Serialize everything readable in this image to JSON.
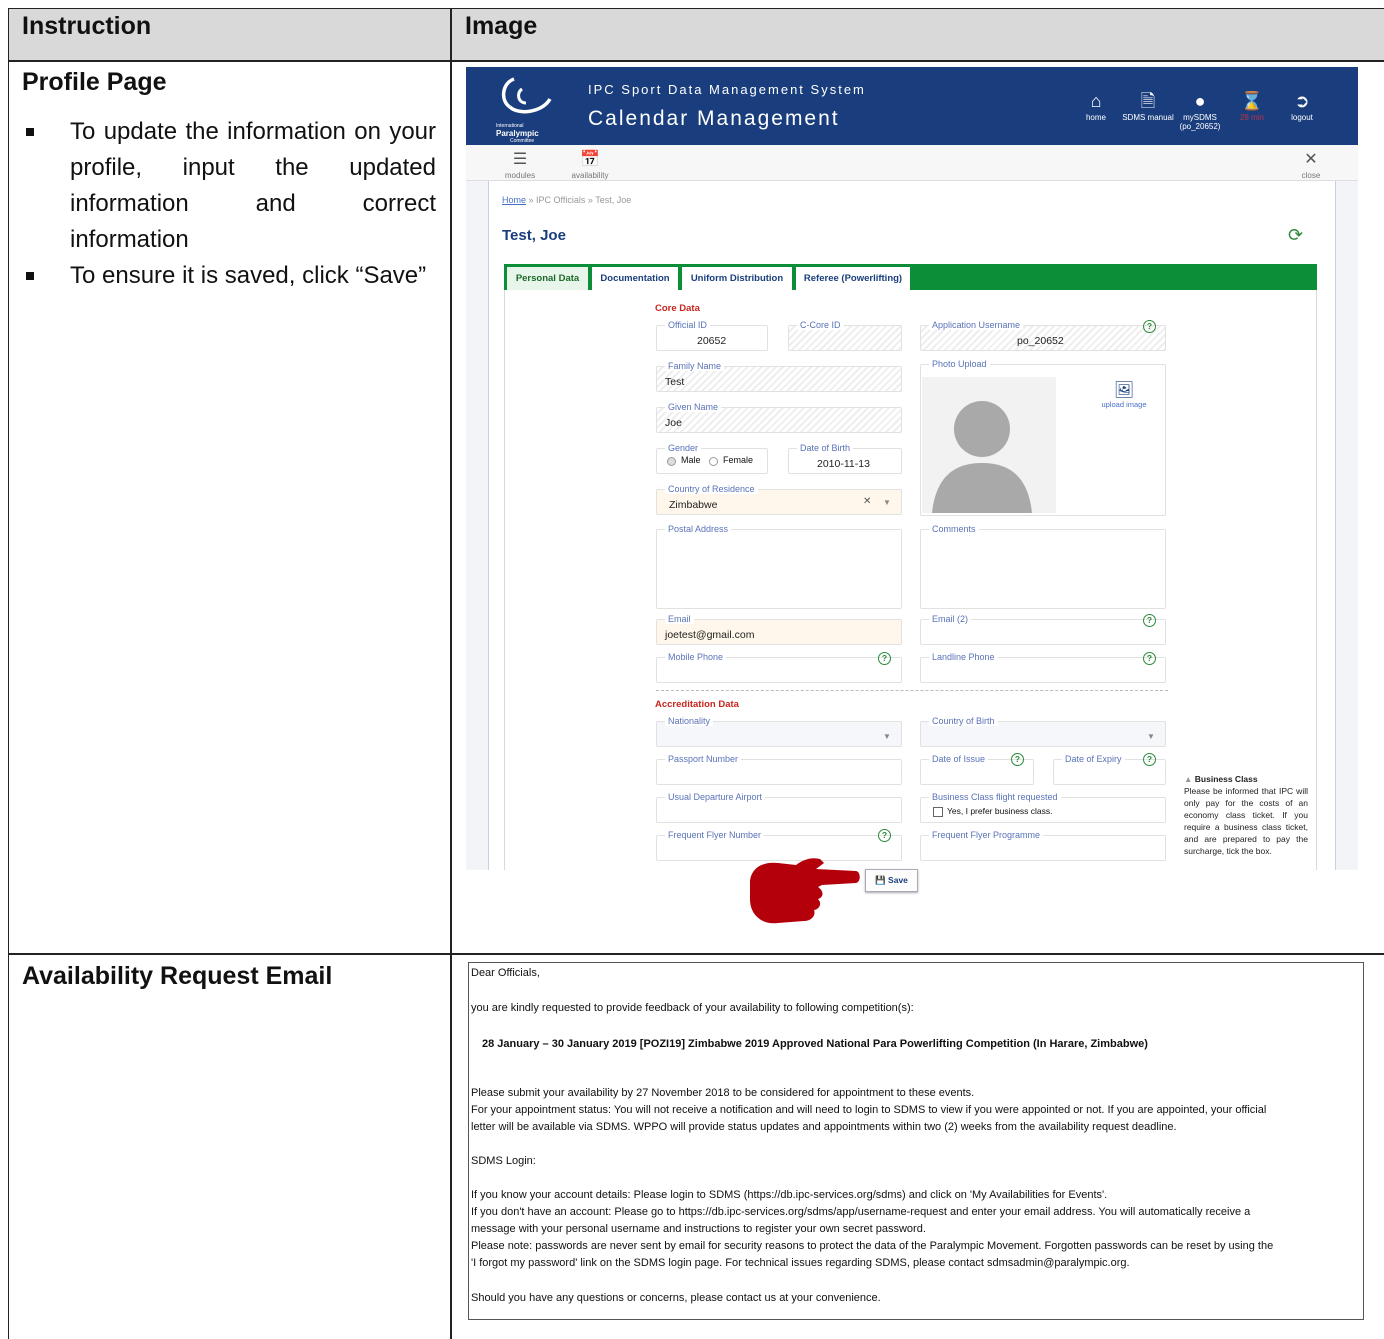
{
  "table": {
    "header": {
      "instruction": "Instruction",
      "image": "Image"
    },
    "rows": [
      {
        "title": "Profile Page",
        "bullets": [
          "To update the information on your profile, input the updated information and correct information",
          "To ensure it is saved, click “Save”"
        ]
      },
      {
        "title": "Availability Request Email"
      }
    ]
  },
  "sdms": {
    "logo_text": [
      "International",
      "Paralympic",
      "Committee"
    ],
    "system_name": "IPC Sport Data Management System",
    "module_name": "Calendar Management",
    "nav": [
      {
        "label": "home",
        "icon": "home-icon"
      },
      {
        "label": "SDMS manual",
        "icon": "pdf-icon"
      },
      {
        "label": "mySDMS\n(po_20652)",
        "icon": "user-icon"
      },
      {
        "label": "28 min",
        "icon": "hourglass-icon"
      },
      {
        "label": "logout",
        "icon": "logout-icon"
      }
    ],
    "toolbar": {
      "modules": "modules",
      "availability": "availability",
      "close": "close"
    },
    "breadcrumb": {
      "home": "Home",
      "rest": " » IPC Officials » Test, Joe"
    },
    "page_title": "Test, Joe",
    "tabs": [
      "Personal Data",
      "Documentation",
      "Uniform Distribution",
      "Referee (Powerlifting)"
    ],
    "core_data_label": "Core Data",
    "fields": {
      "official_id": {
        "label": "Official ID",
        "value": "20652"
      },
      "ccore_id": {
        "label": "C-Core ID",
        "value": ""
      },
      "app_username": {
        "label": "Application Username",
        "value": "po_20652"
      },
      "family_name": {
        "label": "Family Name",
        "value": "Test"
      },
      "photo_upload": {
        "label": "Photo Upload",
        "upload": "upload image"
      },
      "given_name": {
        "label": "Given Name",
        "value": "Joe"
      },
      "gender": {
        "label": "Gender",
        "male": "Male",
        "female": "Female"
      },
      "dob": {
        "label": "Date of Birth",
        "value": "2010-11-13"
      },
      "country": {
        "label": "Country of Residence",
        "value": "Zimbabwe"
      },
      "postal": {
        "label": "Postal Address"
      },
      "comments": {
        "label": "Comments"
      },
      "email": {
        "label": "Email",
        "value": "joetest@gmail.com"
      },
      "email2": {
        "label": "Email (2)"
      },
      "mobile": {
        "label": "Mobile Phone"
      },
      "landline": {
        "label": "Landline Phone"
      }
    },
    "accreditation_label": "Accreditation Data",
    "acc_fields": {
      "nationality": "Nationality",
      "country_birth": "Country of Birth",
      "passport": "Passport Number",
      "date_issue": "Date of Issue",
      "date_expiry": "Date of Expiry",
      "airport": "Usual Departure Airport",
      "business": "Business Class flight requested",
      "business_check": "Yes, I prefer business class.",
      "ff_number": "Frequent Flyer Number",
      "ff_programme": "Frequent Flyer Programme"
    },
    "note": {
      "title": "Business Class",
      "body": "Please be informed that IPC will only pay for the costs of an economy class ticket. If you require a business class ticket, and are prepared to pay the surcharge, tick the box."
    },
    "save_label": "Save"
  },
  "email": {
    "greeting": "Dear Officials,",
    "intro": "you are kindly requested to provide feedback of your availability to following competition(s):",
    "event": "28 January – 30 January 2019 [POZI19] Zimbabwe 2019 Approved National Para Powerlifting Competition (In Harare, Zimbabwe)",
    "deadline": "Please submit your availability by 27 November 2018 to be considered for appointment to these events.",
    "status1": "For your appointment status: You will not receive a notification and will need to login to SDMS to view if you were appointed or not. If you are appointed, your official",
    "status2": "letter will be available via SDMS. WPPO will provide status updates and appointments within two (2) weeks from the availability request deadline.",
    "login_head": "SDMS Login:",
    "login1": "If you know your account details: Please login to SDMS (https://db.ipc-services.org/sdms) and click on 'My Availabilities for Events'.",
    "login2": "If you don't have an account: Please go to https://db.ipc-services.org/sdms/app/username-request and enter your email address. You will automatically receive a",
    "login3": "message with your personal username and instructions to register your own secret password.",
    "login4": "Please note: passwords are never sent by email for security reasons to protect the data of the Paralympic Movement. Forgotten passwords can be reset by using the",
    "login5": "'I forgot my password' link on the SDMS login page. For technical issues regarding SDMS, please contact sdmsadmin@paralympic.org.",
    "closing": "Should you have any questions or concerns, please contact us at your convenience."
  },
  "colors": {
    "header_blue": "#1a3e7d",
    "tab_green": "#0c8e39",
    "section_red": "#c8261e",
    "arrow_red": "#b3000a"
  }
}
